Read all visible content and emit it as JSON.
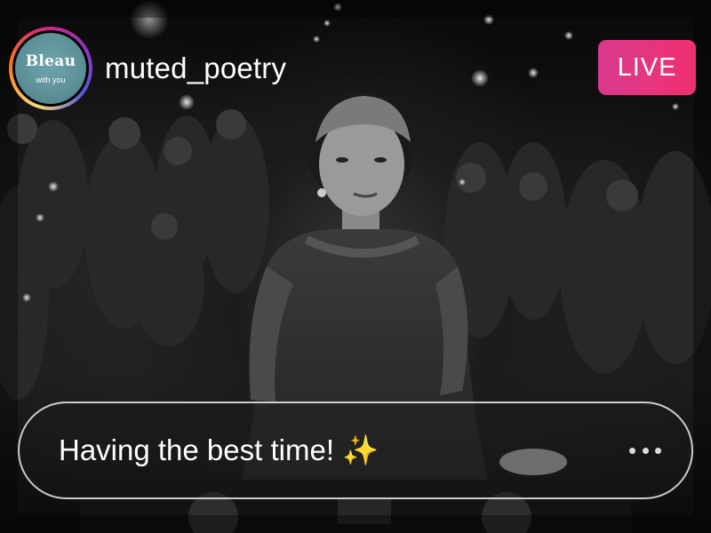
{
  "stream": {
    "username": "muted_poetry",
    "live_label": "LIVE",
    "live_color_start": "#d93a8e",
    "live_color_end": "#f0306f"
  },
  "avatar": {
    "brand": "Bleau",
    "tagline": "with you",
    "ring_colors": [
      "#feda75",
      "#fa7e1e",
      "#d62976",
      "#962fbf",
      "#4f5bd5"
    ]
  },
  "comment": {
    "text": "Having the best time! ✨",
    "more_icon": "more-dots-icon"
  },
  "background": {
    "description_icon": "live-video-frame",
    "tone": "black-and-white"
  }
}
